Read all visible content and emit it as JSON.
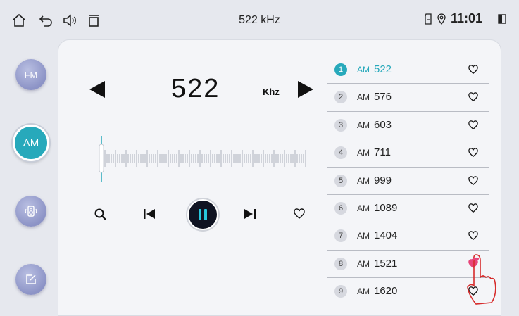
{
  "statusbar": {
    "title": "522 kHz",
    "time": "11:01",
    "icons": [
      "home-icon",
      "back-icon",
      "volume-icon",
      "recent-apps-icon",
      "sd-card-icon",
      "location-icon",
      "battery-icon"
    ]
  },
  "sidebar": {
    "items": [
      {
        "label": "FM",
        "icon": null
      },
      {
        "label": "AM",
        "icon": null,
        "active": true
      },
      {
        "label": "",
        "icon": "speaker-icon"
      },
      {
        "label": "",
        "icon": "edit-icon"
      }
    ]
  },
  "tuner": {
    "frequency": "522",
    "unit": "Khz"
  },
  "controls": [
    "search-icon",
    "prev-icon",
    "pause-icon",
    "next-icon",
    "heart-icon"
  ],
  "presets": [
    {
      "num": "1",
      "band": "AM",
      "freq": "522",
      "active": true
    },
    {
      "num": "2",
      "band": "AM",
      "freq": "576"
    },
    {
      "num": "3",
      "band": "AM",
      "freq": "603"
    },
    {
      "num": "4",
      "band": "AM",
      "freq": "711"
    },
    {
      "num": "5",
      "band": "AM",
      "freq": "999"
    },
    {
      "num": "6",
      "band": "AM",
      "freq": "1089"
    },
    {
      "num": "7",
      "band": "AM",
      "freq": "1404"
    },
    {
      "num": "8",
      "band": "AM",
      "freq": "1521",
      "favorite": true
    },
    {
      "num": "9",
      "band": "AM",
      "freq": "1620"
    }
  ],
  "colors": {
    "accent": "#27a9bb",
    "favorite": "#e8457a",
    "side_button": "#8c93c6"
  }
}
